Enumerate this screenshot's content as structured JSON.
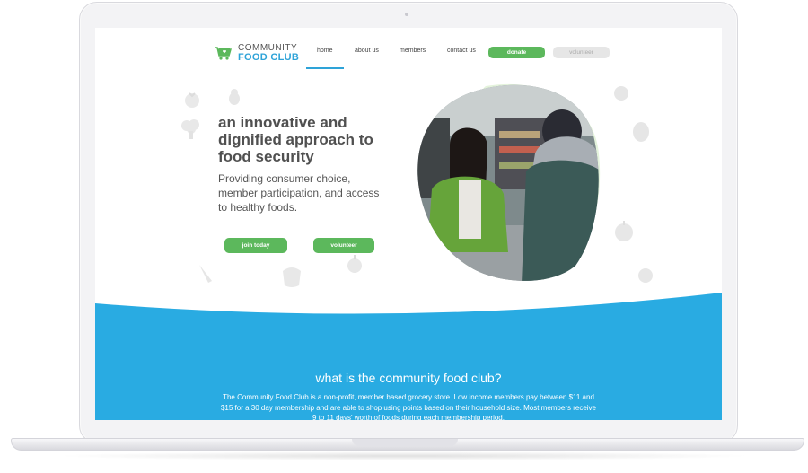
{
  "site": {
    "logo": {
      "line1": "COMMUNITY",
      "line2": "FOOD CLUB"
    },
    "nav": {
      "home": "home",
      "about": "about us",
      "members": "members",
      "contact": "contact us",
      "donate": "donate",
      "volunteer": "volunteer"
    },
    "hero": {
      "title": "an innovative and dignified approach to food security",
      "subtitle": "Providing consumer choice, member participation, and access to healthy foods.",
      "join_button": "join today",
      "volunteer_button": "volunteer"
    },
    "section": {
      "title": "what is the community food club?",
      "body": "The Community Food Club is a non-profit, member based grocery store. Low income members pay between $11 and $15 for a 30 day membership and are able to shop using points based on their household size. Most members receive 9 to 11 days' worth of foods during each membership period."
    },
    "colors": {
      "accent_green": "#5cb85c",
      "accent_blue": "#2ea3d8",
      "section_blue": "#29abe2"
    }
  }
}
